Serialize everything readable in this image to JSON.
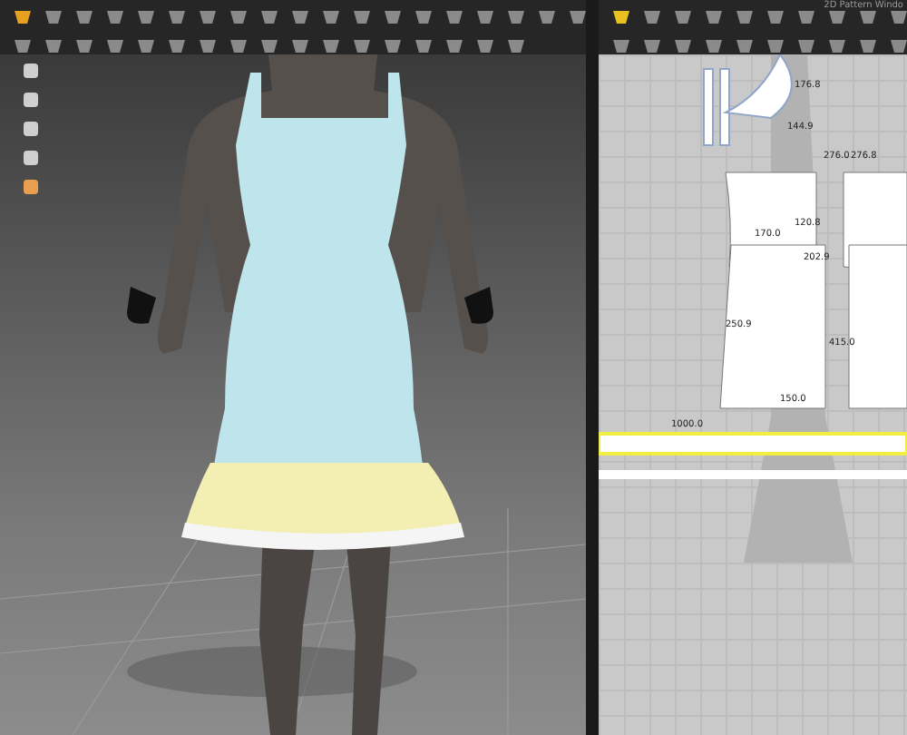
{
  "pattern_window": {
    "title": "2D Pattern Windo",
    "measurements": [
      "176.8",
      "144.9",
      "276.0",
      "276.8",
      "120.8",
      "170.0",
      "202.9",
      "250.9",
      "415.0",
      "150.0",
      "1000.0"
    ]
  }
}
